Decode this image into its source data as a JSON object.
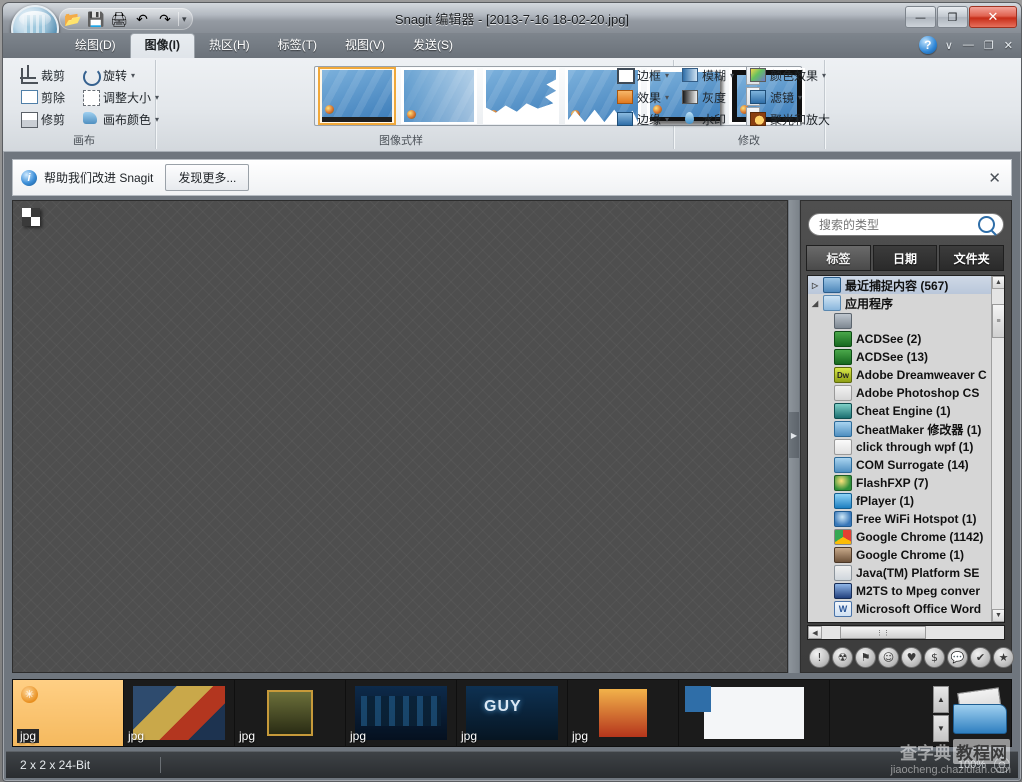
{
  "window": {
    "title": "Snagit 编辑器 - [2013-7-16 18-02-20.jpg]",
    "minimize_label": "—",
    "restore_label": "❐",
    "close_label": "✕"
  },
  "quick_access": {
    "items": [
      {
        "name": "open-icon",
        "glyph": "📂"
      },
      {
        "name": "save-icon",
        "glyph": "💾"
      },
      {
        "name": "print-icon",
        "glyph": "🖨"
      },
      {
        "name": "undo-icon",
        "glyph": "↶"
      },
      {
        "name": "redo-icon",
        "glyph": "↷"
      }
    ],
    "customize_caret": "▾"
  },
  "ribbon": {
    "tabs": [
      {
        "label": "绘图(D)",
        "active": false
      },
      {
        "label": "图像(I)",
        "active": true
      },
      {
        "label": "热区(H)",
        "active": false
      },
      {
        "label": "标签(T)",
        "active": false
      },
      {
        "label": "视图(V)",
        "active": false
      },
      {
        "label": "发送(S)",
        "active": false
      }
    ],
    "help_label": "?",
    "caret_label": "∨",
    "minimize_label": "—",
    "restore_label": "❐",
    "close_label": "✕",
    "groups": {
      "canvas": {
        "label": "画布",
        "commands": [
          {
            "label": "裁剪",
            "icon": "crop-icon",
            "dropdown": ""
          },
          {
            "label": "旋转",
            "icon": "rotate-icon",
            "dropdown": "▾"
          },
          {
            "label": "剪除",
            "icon": "cutout-icon",
            "dropdown": ""
          },
          {
            "label": "调整大小",
            "icon": "resize-icon",
            "dropdown": "▾"
          },
          {
            "label": "修剪",
            "icon": "trim-icon",
            "dropdown": ""
          },
          {
            "label": "画布颜色",
            "icon": "canvas-color-icon",
            "dropdown": "▾"
          }
        ]
      },
      "styles": {
        "label": "图像式样",
        "thumbnails": [
          {
            "name": "style-plain",
            "selected": true
          },
          {
            "name": "style-fade",
            "selected": false
          },
          {
            "name": "style-torn",
            "selected": false
          },
          {
            "name": "style-wave",
            "selected": false
          },
          {
            "name": "style-shadow",
            "selected": false
          },
          {
            "name": "style-border",
            "selected": false
          }
        ],
        "scroll_up": "▲",
        "scroll_down": "▼",
        "scroll_more": "▤"
      },
      "edges": {
        "commands": [
          {
            "label": "边框",
            "icon": "border-icon",
            "dropdown": "▾"
          },
          {
            "label": "效果",
            "icon": "effects-icon",
            "dropdown": "▾"
          },
          {
            "label": "边缘",
            "icon": "edge-icon",
            "dropdown": "▾"
          }
        ]
      },
      "modify": {
        "label": "修改",
        "commands": [
          {
            "label": "模糊",
            "icon": "blur-icon",
            "dropdown": "▾"
          },
          {
            "label": "颜色效果",
            "icon": "color-effect-icon",
            "dropdown": "▾"
          },
          {
            "label": "灰度",
            "icon": "grayscale-icon",
            "dropdown": ""
          },
          {
            "label": "滤镜",
            "icon": "filter-icon",
            "dropdown": "▾"
          },
          {
            "label": "水印",
            "icon": "watermark-icon",
            "dropdown": ""
          },
          {
            "label": "聚光和放大",
            "icon": "spotlight-magnify-icon",
            "dropdown": ""
          }
        ]
      }
    }
  },
  "infobar": {
    "icon": "info-icon",
    "text": "帮助我们改进 Snagit",
    "button_label": "发现更多...",
    "close_label": "✕"
  },
  "canvas": {
    "image_name": "2x2-checker-image"
  },
  "splitter": {
    "handle_glyph": "▶"
  },
  "sidebar": {
    "search": {
      "placeholder": "搜索的类型",
      "value": "",
      "icon": "search-icon"
    },
    "tabs": [
      {
        "label": "标签",
        "active": true
      },
      {
        "label": "日期",
        "active": false
      },
      {
        "label": "文件夹",
        "active": false
      }
    ],
    "tree": [
      {
        "label": "最近捕捉内容 (567)",
        "icon": "recent-captures-icon",
        "expander": "▷",
        "indent": 0,
        "selected": true
      },
      {
        "label": "应用程序",
        "icon": "applications-folder-icon",
        "expander": "◢",
        "indent": 0,
        "selected": false
      },
      {
        "label": "",
        "icon": "image-app-icon",
        "expander": "",
        "indent": 1,
        "selected": false
      },
      {
        "label": "ACDSee (2)",
        "icon": "acdsee-icon",
        "expander": "",
        "indent": 1,
        "selected": false
      },
      {
        "label": "ACDSee (13)",
        "icon": "acdsee-icon",
        "expander": "",
        "indent": 1,
        "selected": false
      },
      {
        "label": "Adobe Dreamweaver C",
        "icon": "dreamweaver-icon",
        "expander": "",
        "indent": 1,
        "selected": false
      },
      {
        "label": "Adobe Photoshop CS",
        "icon": "photoshop-icon",
        "expander": "",
        "indent": 1,
        "selected": false
      },
      {
        "label": "Cheat Engine (1)",
        "icon": "cheat-engine-icon",
        "expander": "",
        "indent": 1,
        "selected": false
      },
      {
        "label": "CheatMaker 修改器 (1)",
        "icon": "window-icon",
        "expander": "",
        "indent": 1,
        "selected": false
      },
      {
        "label": "click through wpf (1)",
        "icon": "pencil-icon",
        "expander": "",
        "indent": 1,
        "selected": false
      },
      {
        "label": "COM Surrogate (14)",
        "icon": "window-icon",
        "expander": "",
        "indent": 1,
        "selected": false
      },
      {
        "label": "FlashFXP (7)",
        "icon": "flashfxp-icon",
        "expander": "",
        "indent": 1,
        "selected": false
      },
      {
        "label": "fPlayer (1)",
        "icon": "fplayer-icon",
        "expander": "",
        "indent": 1,
        "selected": false
      },
      {
        "label": "Free WiFi Hotspot (1)",
        "icon": "wifi-icon",
        "expander": "",
        "indent": 1,
        "selected": false
      },
      {
        "label": "Google Chrome (1142)",
        "icon": "chrome-icon",
        "expander": "",
        "indent": 1,
        "selected": false
      },
      {
        "label": "Google Chrome (1)",
        "icon": "avatar-icon",
        "expander": "",
        "indent": 1,
        "selected": false
      },
      {
        "label": "Java(TM) Platform SE",
        "icon": "java-icon",
        "expander": "",
        "indent": 1,
        "selected": false
      },
      {
        "label": "M2TS to Mpeg conver",
        "icon": "m2ts-icon",
        "expander": "",
        "indent": 1,
        "selected": false
      },
      {
        "label": "Microsoft Office Word",
        "icon": "word-icon",
        "expander": "",
        "indent": 1,
        "selected": false
      }
    ],
    "vscroll": {
      "up": "▲",
      "down": "▼",
      "thumb": "≡"
    },
    "hscroll": {
      "left": "◀",
      "right": "▶",
      "thumb": "⋮⋮"
    },
    "stamps": [
      {
        "name": "stamp-exclamation",
        "glyph": "!"
      },
      {
        "name": "stamp-radiation",
        "glyph": "☢"
      },
      {
        "name": "stamp-flag",
        "glyph": "⚑"
      },
      {
        "name": "stamp-smiley",
        "glyph": "☺"
      },
      {
        "name": "stamp-heart",
        "glyph": "♥"
      },
      {
        "name": "stamp-dollar",
        "glyph": "$"
      },
      {
        "name": "stamp-speech",
        "glyph": "💬"
      },
      {
        "name": "stamp-check",
        "glyph": "✔"
      },
      {
        "name": "stamp-star",
        "glyph": "★"
      }
    ]
  },
  "filmstrip": {
    "items": [
      {
        "label": "jpg",
        "name": "thumb-selected-blank",
        "selected": true
      },
      {
        "label": "jpg",
        "name": "thumb-books",
        "selected": false
      },
      {
        "label": "jpg",
        "name": "thumb-game-icon",
        "selected": false
      },
      {
        "label": "jpg",
        "name": "thumb-arcade",
        "selected": false
      },
      {
        "label": "jpg",
        "name": "thumb-guy",
        "selected": false
      },
      {
        "label": "jpg",
        "name": "thumb-hero",
        "selected": false
      },
      {
        "label": "",
        "name": "thumb-document",
        "selected": false
      }
    ],
    "scroll_up": "▲",
    "scroll_down": "▼",
    "folder_icon": "open-folder-icon"
  },
  "statusbar": {
    "dimensions": "2 x 2 x 24-Bit",
    "zoom": "100%",
    "zoom_out_label": "⊖"
  },
  "watermark": {
    "site_cn": "查字典 教程网",
    "site_url": "jiaocheng.chazidian.com"
  },
  "colors": {
    "accent_orange": "#f0a83a",
    "close_red": "#c62d18",
    "selection_blue": "#b9c7da",
    "titlebar": "#b2b8c0",
    "canvas_gray": "#4e4e4e",
    "sidebar_dark": "#3c3c3c"
  }
}
